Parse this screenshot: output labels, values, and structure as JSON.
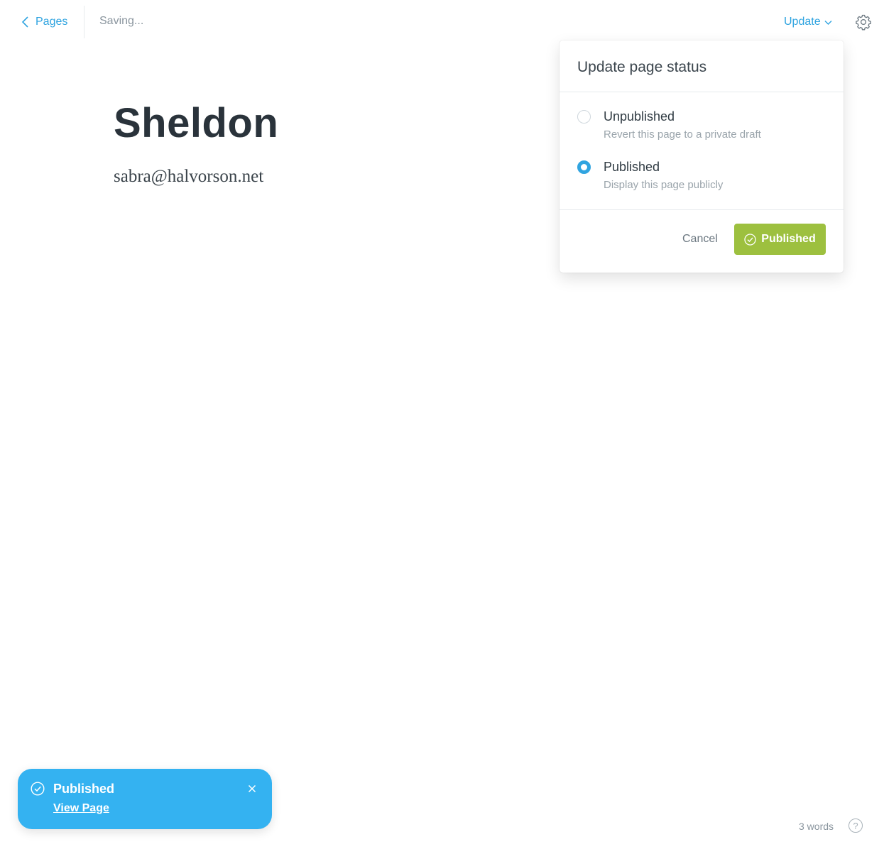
{
  "topbar": {
    "back_label": "Pages",
    "status_text": "Saving...",
    "update_label": "Update"
  },
  "editor": {
    "title": "Sheldon",
    "body": "sabra@halvorson.net"
  },
  "popover": {
    "title": "Update page status",
    "options": [
      {
        "label": "Unpublished",
        "description": "Revert this page to a private draft",
        "selected": false
      },
      {
        "label": "Published",
        "description": "Display this page publicly",
        "selected": true
      }
    ],
    "cancel_label": "Cancel",
    "confirm_label": "Published"
  },
  "toast": {
    "title": "Published",
    "link_label": "View Page"
  },
  "footer": {
    "word_count": "3 words",
    "help_label": "?"
  },
  "colors": {
    "accent": "#30a4e0",
    "publish_green": "#9dc03f",
    "toast_blue": "#34b2f1"
  }
}
